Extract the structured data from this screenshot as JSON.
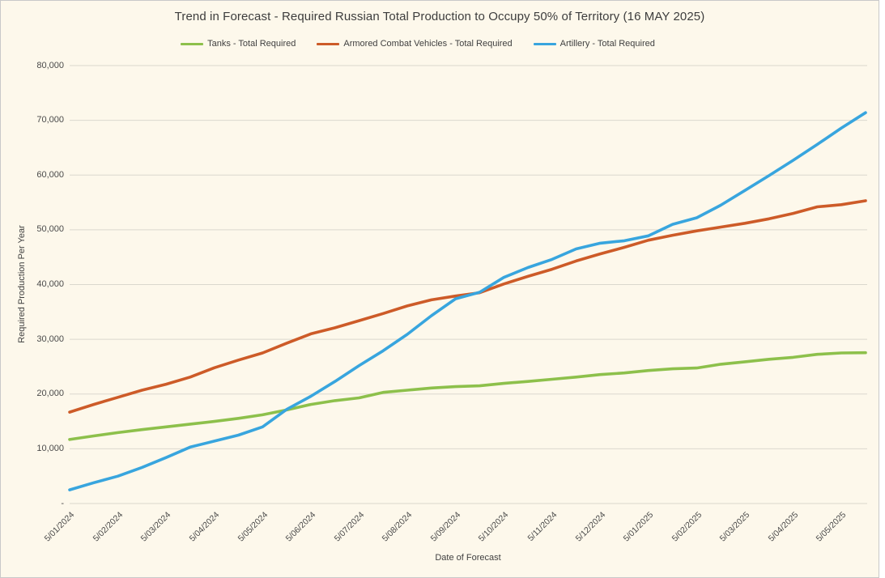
{
  "palette": {
    "panel_background": "#FDF8EB",
    "panel_border": "#C9C9C9",
    "gridline": "#DBD8CE",
    "text": "#3F3F3F",
    "tick_text": "#4A4A4A",
    "tanks_green": "#8DC04B",
    "acv_orange": "#CD5B28",
    "artillery_blue": "#38A5DE"
  },
  "chart_data": {
    "type": "line",
    "title": "Trend in Forecast - Required Russian Total Production to Occupy 50% of Territory (16 MAY 2025)",
    "xlabel": "Date of Forecast",
    "ylabel": "Required Production Per Year",
    "ylim": [
      0,
      80000
    ],
    "grid": "horizontal",
    "legend_position": "top",
    "yticks": [
      {
        "v": 80000,
        "label": "80,000"
      },
      {
        "v": 70000,
        "label": "70,000"
      },
      {
        "v": 60000,
        "label": "60,000"
      },
      {
        "v": 50000,
        "label": "50,000"
      },
      {
        "v": 40000,
        "label": "40,000"
      },
      {
        "v": 30000,
        "label": "30,000"
      },
      {
        "v": 20000,
        "label": "20,000"
      },
      {
        "v": 10000,
        "label": "10,000"
      },
      {
        "v": 0,
        "label": "-"
      }
    ],
    "categories": [
      "5/01/2024",
      "5/02/2024",
      "5/03/2024",
      "5/04/2024",
      "5/05/2024",
      "5/06/2024",
      "5/07/2024",
      "5/08/2024",
      "5/09/2024",
      "5/10/2024",
      "5/11/2024",
      "5/12/2024",
      "5/01/2025",
      "5/02/2025",
      "5/03/2025",
      "5/04/2025",
      "5/05/2025"
    ],
    "samples_per_category": 2,
    "series": [
      {
        "name": "Tanks - Total Required",
        "color": "#8DC04B",
        "values": [
          11700,
          12350,
          12950,
          13500,
          14000,
          14500,
          15000,
          15550,
          16200,
          17100,
          18100,
          18800,
          19300,
          20300,
          20700,
          21100,
          21350,
          21500,
          21950,
          22300,
          22700,
          23100,
          23550,
          23850,
          24300,
          24600,
          24750,
          25450,
          25900,
          26350,
          26700,
          27250,
          27500,
          27550
        ]
      },
      {
        "name": "Armored Combat Vehicles - Total Required",
        "color": "#CD5B28",
        "values": [
          16700,
          18100,
          19400,
          20700,
          21800,
          23100,
          24800,
          26200,
          27500,
          29300,
          31000,
          32100,
          33400,
          34700,
          36100,
          37200,
          37900,
          38500,
          40100,
          41500,
          42800,
          44300,
          45600,
          46800,
          48100,
          49000,
          49800,
          50500,
          51200,
          52000,
          53000,
          54200,
          54600,
          55300
        ]
      },
      {
        "name": "Artillery - Total Required",
        "color": "#38A5DE",
        "values": [
          2500,
          3800,
          5000,
          6600,
          8400,
          10300,
          11400,
          12500,
          14000,
          17200,
          19600,
          22300,
          25200,
          27900,
          30900,
          34300,
          37400,
          38600,
          41300,
          43100,
          44600,
          46500,
          47550,
          48000,
          48900,
          51000,
          52200,
          54500,
          57200,
          59900,
          62700,
          65600,
          68600,
          71400
        ]
      }
    ]
  }
}
